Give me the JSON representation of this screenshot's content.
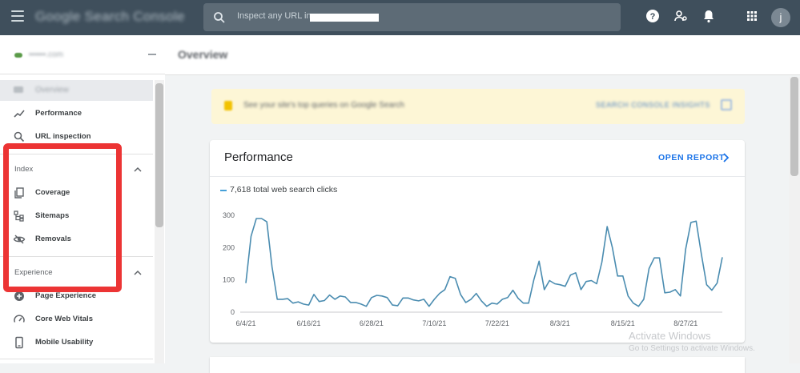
{
  "header": {
    "app_title": "Google Search Console",
    "search_placeholder": "Inspect any URL in",
    "avatar_initial": "j"
  },
  "sidebar": {
    "property": "▪▪▪▪▪▪.com",
    "overview": "Overview",
    "top_items": [
      {
        "label": "Performance",
        "icon": "trending-up-icon"
      },
      {
        "label": "URL inspection",
        "icon": "search-icon"
      }
    ],
    "index": {
      "label": "Index",
      "items": [
        {
          "label": "Coverage",
          "icon": "coverage-icon"
        },
        {
          "label": "Sitemaps",
          "icon": "sitemap-icon"
        },
        {
          "label": "Removals",
          "icon": "eye-off-icon"
        }
      ]
    },
    "experience": {
      "label": "Experience",
      "items": [
        {
          "label": "Page Experience",
          "icon": "add-circle-icon"
        },
        {
          "label": "Core Web Vitals",
          "icon": "speed-icon"
        },
        {
          "label": "Mobile Usability",
          "icon": "phone-icon"
        }
      ]
    },
    "highlight_color": "#ec3434"
  },
  "main": {
    "page_title": "Overview",
    "banner": {
      "text": "See your site's top queries on Google Search",
      "action": "SEARCH CONSOLE INSIGHTS"
    },
    "performance": {
      "title": "Performance",
      "open_report": "OPEN REPORT",
      "legend": "7,618 total web search clicks"
    }
  },
  "watermark": {
    "line1": "Activate Windows",
    "line2": "Go to Settings to activate Windows."
  },
  "chart_data": {
    "type": "line",
    "series": [
      {
        "name": "7,618 total web search clicks",
        "color": "#4a8cb0",
        "values": [
          90,
          235,
          290,
          290,
          280,
          140,
          40,
          40,
          42,
          28,
          32,
          25,
          22,
          55,
          33,
          36,
          53,
          40,
          50,
          47,
          30,
          30,
          25,
          18,
          45,
          52,
          50,
          45,
          22,
          20,
          44,
          44,
          38,
          35,
          40,
          18,
          40,
          58,
          70,
          110,
          105,
          55,
          30,
          40,
          58,
          35,
          18,
          28,
          25,
          40,
          45,
          68,
          43,
          28,
          28,
          100,
          158,
          70,
          98,
          88,
          85,
          80,
          115,
          122,
          70,
          95,
          98,
          88,
          155,
          265,
          200,
          112,
          112,
          50,
          28,
          18,
          40,
          135,
          168,
          168,
          60,
          62,
          70,
          50,
          195,
          278,
          282,
          180,
          85,
          68,
          90,
          170
        ]
      }
    ],
    "x_labels": [
      "6/4/21",
      "6/16/21",
      "6/28/21",
      "7/10/21",
      "7/22/21",
      "8/3/21",
      "8/15/21",
      "8/27/21"
    ],
    "x_label_index": [
      0,
      12,
      24,
      36,
      48,
      60,
      72,
      84
    ],
    "y_ticks": [
      0,
      100,
      200,
      300
    ],
    "ylim": [
      0,
      300
    ]
  }
}
